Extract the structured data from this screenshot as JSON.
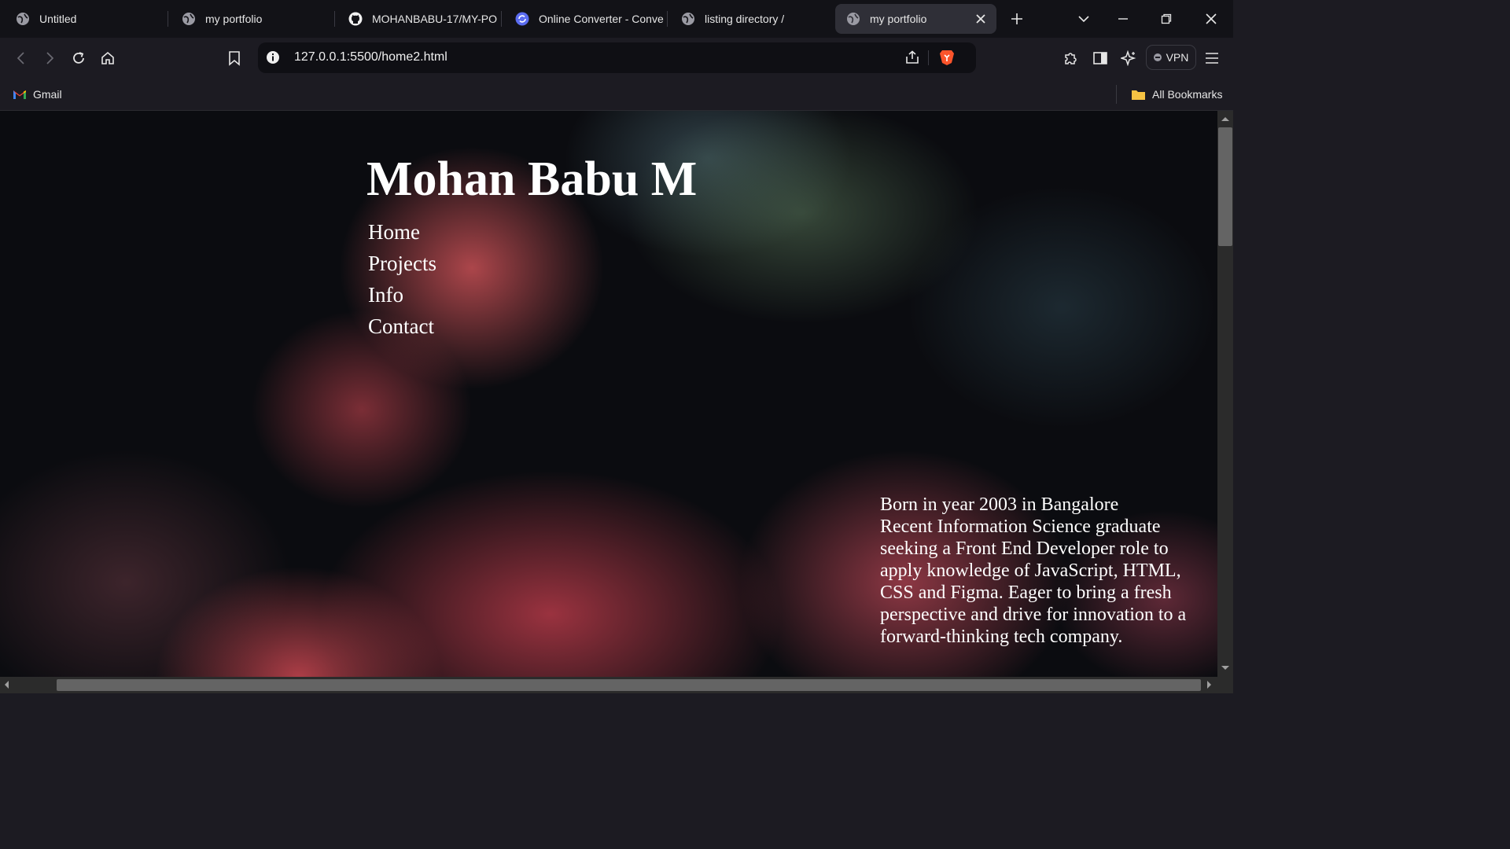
{
  "browser": {
    "tabs": [
      {
        "title": "Untitled",
        "icon": "globe-icon",
        "active": false
      },
      {
        "title": "my portfolio",
        "icon": "globe-icon",
        "active": false
      },
      {
        "title": "MOHANBABU-17/MY-PO",
        "icon": "github-icon",
        "active": false
      },
      {
        "title": "Online Converter - Conve",
        "icon": "converter-icon",
        "active": false
      },
      {
        "title": "listing directory /",
        "icon": "globe-icon",
        "active": false
      },
      {
        "title": "my portfolio",
        "icon": "globe-icon",
        "active": true
      }
    ],
    "url": "127.0.0.1:5500/home2.html",
    "vpn_label": "VPN",
    "bookmarks": {
      "gmail": "Gmail",
      "all_bookmarks": "All Bookmarks"
    },
    "colors": {
      "tabstrip_bg": "#121217",
      "toolbar_bg": "#1c1b22",
      "active_tab_bg": "#2f2f37",
      "brave_orange": "#fb542b"
    }
  },
  "page": {
    "title": "Mohan Babu M",
    "nav": [
      "Home",
      "Projects",
      "Info",
      "Contact"
    ],
    "bio": "Born in year 2003 in Bangalore\nRecent Information Science graduate seeking a Front End Developer role to apply knowledge of JavaScript, HTML, CSS and Figma. Eager to bring a fresh perspective and drive for innovation to a forward-thinking tech company."
  }
}
